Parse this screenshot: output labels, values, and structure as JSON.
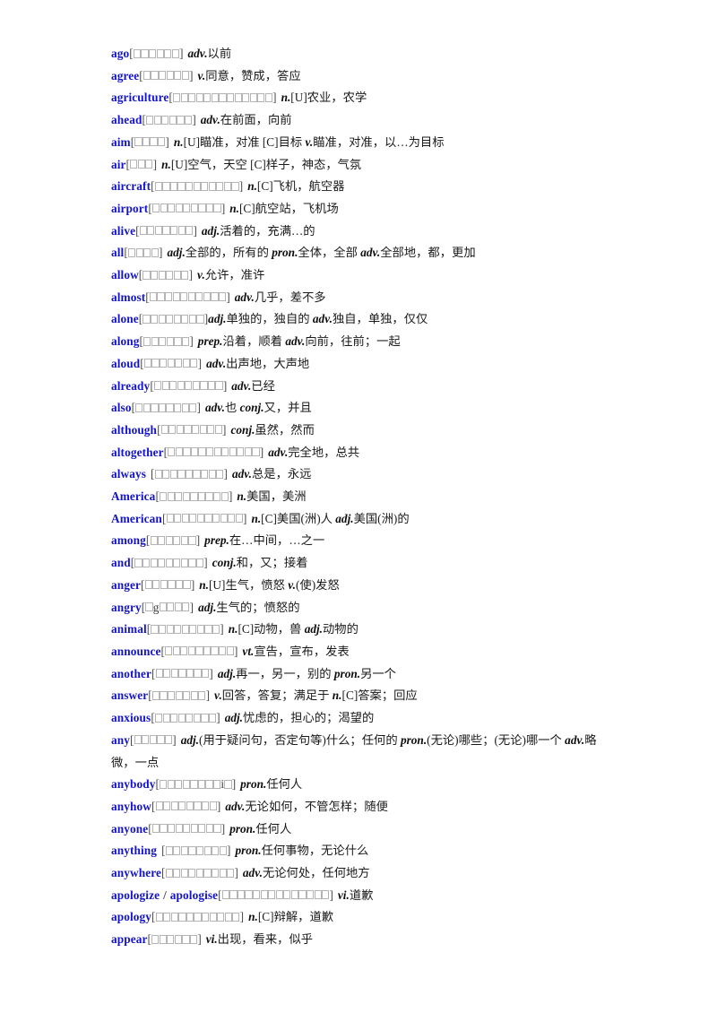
{
  "document": {
    "type": "vocabulary-word-list",
    "page_background": "#ffffff",
    "headword_color": "#1414c8",
    "text_color": "#1a1a1a",
    "phonetic_box_color": "#b4b4b4",
    "note": "Phonetic transcriptions render as missing-glyph (tofu) boxes."
  },
  "entries": [
    {
      "word": "ago",
      "space_before_bracket": false,
      "phonetic_boxes": 6,
      "phonetic_literals": {},
      "space_after_bracket": true,
      "senses": "adv.以前"
    },
    {
      "word": "agree",
      "space_before_bracket": false,
      "phonetic_boxes": 6,
      "phonetic_literals": {},
      "space_after_bracket": true,
      "senses": "v.同意，赞成，答应"
    },
    {
      "word": "agriculture",
      "space_before_bracket": false,
      "phonetic_boxes": 13,
      "phonetic_literals": {},
      "space_after_bracket": true,
      "senses": "n.[U]农业，农学"
    },
    {
      "word": "ahead",
      "space_before_bracket": false,
      "phonetic_boxes": 6,
      "phonetic_literals": {},
      "space_after_bracket": true,
      "senses": "adv.在前面，向前"
    },
    {
      "word": "aim",
      "space_before_bracket": false,
      "phonetic_boxes": 4,
      "phonetic_literals": {},
      "space_after_bracket": true,
      "senses": "n.[U]瞄准，对准 [C]目标 v.瞄准，对准，以…为目标"
    },
    {
      "word": "air",
      "space_before_bracket": false,
      "phonetic_boxes": 3,
      "phonetic_literals": {},
      "space_after_bracket": true,
      "senses": "n.[U]空气，天空 [C]样子，神态，气氛"
    },
    {
      "word": "aircraft",
      "space_before_bracket": false,
      "phonetic_boxes": 11,
      "phonetic_literals": {},
      "space_after_bracket": true,
      "senses": "n.[C]飞机，航空器"
    },
    {
      "word": "airport",
      "space_before_bracket": false,
      "phonetic_boxes": 9,
      "phonetic_literals": {},
      "space_after_bracket": true,
      "senses": "n.[C]航空站，飞机场"
    },
    {
      "word": "alive",
      "space_before_bracket": false,
      "phonetic_boxes": 7,
      "phonetic_literals": {},
      "space_after_bracket": true,
      "senses": "adj.活着的，充满…的"
    },
    {
      "word": "all",
      "space_before_bracket": false,
      "phonetic_boxes": 4,
      "phonetic_literals": {},
      "space_after_bracket": true,
      "senses": "adj.全部的，所有的 pron.全体，全部 adv.全部地，都，更加"
    },
    {
      "word": "allow",
      "space_before_bracket": false,
      "phonetic_boxes": 6,
      "phonetic_literals": {},
      "space_after_bracket": true,
      "senses": "v.允许，准许"
    },
    {
      "word": "almost",
      "space_before_bracket": false,
      "phonetic_boxes": 10,
      "phonetic_literals": {},
      "space_after_bracket": true,
      "senses": "adv.几乎，差不多"
    },
    {
      "word": "alone",
      "space_before_bracket": false,
      "phonetic_boxes": 8,
      "phonetic_literals": {},
      "space_after_bracket": false,
      "senses": "adj.单独的，独自的 adv.独自，单独，仅仅"
    },
    {
      "word": "along",
      "space_before_bracket": false,
      "phonetic_boxes": 6,
      "phonetic_literals": {},
      "space_after_bracket": true,
      "senses": "prep.沿着，顺着 adv.向前，往前；一起"
    },
    {
      "word": "aloud",
      "space_before_bracket": false,
      "phonetic_boxes": 7,
      "phonetic_literals": {},
      "space_after_bracket": true,
      "senses": "adv.出声地，大声地"
    },
    {
      "word": "already",
      "space_before_bracket": false,
      "phonetic_boxes": 9,
      "phonetic_literals": {},
      "space_after_bracket": true,
      "senses": "adv.已经"
    },
    {
      "word": "also",
      "space_before_bracket": false,
      "phonetic_boxes": 8,
      "phonetic_literals": {},
      "space_after_bracket": true,
      "senses": "adv.也 conj.又，并且"
    },
    {
      "word": "although",
      "space_before_bracket": false,
      "phonetic_boxes": 8,
      "phonetic_literals": {},
      "space_after_bracket": true,
      "senses": "conj.虽然，然而"
    },
    {
      "word": "altogether",
      "space_before_bracket": false,
      "phonetic_boxes": 12,
      "phonetic_literals": {},
      "space_after_bracket": true,
      "senses": "adv.完全地，总共"
    },
    {
      "word": "always",
      "space_before_bracket": true,
      "phonetic_boxes": 9,
      "phonetic_literals": {},
      "space_after_bracket": true,
      "senses": "adv.总是，永远"
    },
    {
      "word": "America",
      "space_before_bracket": false,
      "phonetic_boxes": 9,
      "phonetic_literals": {},
      "space_after_bracket": true,
      "senses": "n.美国，美洲"
    },
    {
      "word": "American",
      "space_before_bracket": false,
      "phonetic_boxes": 10,
      "phonetic_literals": {},
      "space_after_bracket": true,
      "senses": "n.[C]美国(洲)人 adj.美国(洲)的"
    },
    {
      "word": "among",
      "space_before_bracket": false,
      "phonetic_boxes": 6,
      "phonetic_literals": {},
      "space_after_bracket": true,
      "senses": "prep.在…中间，…之一"
    },
    {
      "word": "and",
      "space_before_bracket": false,
      "phonetic_boxes": 9,
      "phonetic_literals": {},
      "space_after_bracket": true,
      "senses": "conj.和，又；接着"
    },
    {
      "word": "anger",
      "space_before_bracket": false,
      "phonetic_boxes": 6,
      "phonetic_literals": {},
      "space_after_bracket": true,
      "senses": "n.[U]生气，愤怒 v.(使)发怒"
    },
    {
      "word": "angry",
      "space_before_bracket": false,
      "phonetic_boxes": 6,
      "phonetic_literals": {
        "2": "g"
      },
      "space_after_bracket": true,
      "senses": "adj.生气的；愤怒的"
    },
    {
      "word": "animal",
      "space_before_bracket": false,
      "phonetic_boxes": 9,
      "phonetic_literals": {},
      "space_after_bracket": true,
      "senses": "n.[C]动物，兽 adj.动物的"
    },
    {
      "word": "announce",
      "space_before_bracket": false,
      "phonetic_boxes": 9,
      "phonetic_literals": {},
      "space_after_bracket": true,
      "senses": "vt.宣告，宣布，发表"
    },
    {
      "word": "another",
      "space_before_bracket": false,
      "phonetic_boxes": 7,
      "phonetic_literals": {},
      "space_after_bracket": true,
      "senses": "adj.再一，另一，别的 pron.另一个"
    },
    {
      "word": "answer",
      "space_before_bracket": false,
      "phonetic_boxes": 7,
      "phonetic_literals": {},
      "space_after_bracket": true,
      "senses": "v.回答，答复；满足于 n.[C]答案；回应"
    },
    {
      "word": "anxious",
      "space_before_bracket": false,
      "phonetic_boxes": 8,
      "phonetic_literals": {},
      "space_after_bracket": true,
      "senses": "adj.忧虑的，担心的；渴望的"
    },
    {
      "word": "any",
      "space_before_bracket": false,
      "phonetic_boxes": 5,
      "phonetic_literals": {},
      "space_after_bracket": true,
      "senses": "adj.(用于疑问句，否定句等)什么；任何的 pron.(无论)哪些；(无论)哪一个 adv.略微，一点"
    },
    {
      "word": "anybody",
      "space_before_bracket": false,
      "phonetic_boxes": 10,
      "phonetic_literals": {
        "9": "i"
      },
      "space_after_bracket": true,
      "senses": "pron.任何人"
    },
    {
      "word": "anyhow",
      "space_before_bracket": false,
      "phonetic_boxes": 8,
      "phonetic_literals": {},
      "space_after_bracket": true,
      "senses": "adv.无论如何，不管怎样；随便"
    },
    {
      "word": "anyone",
      "space_before_bracket": false,
      "phonetic_boxes": 9,
      "phonetic_literals": {},
      "space_after_bracket": true,
      "senses": "pron.任何人"
    },
    {
      "word": "anything",
      "space_before_bracket": true,
      "phonetic_boxes": 8,
      "phonetic_literals": {},
      "space_after_bracket": true,
      "senses": "pron.任何事物，无论什么"
    },
    {
      "word": "anywhere",
      "space_before_bracket": false,
      "phonetic_boxes": 9,
      "phonetic_literals": {},
      "space_after_bracket": true,
      "senses": "adv.无论何处，任何地方"
    },
    {
      "word": "apologize",
      "alt_word": "apologise",
      "separator": "/",
      "space_before_bracket": false,
      "phonetic_boxes": 14,
      "phonetic_literals": {},
      "space_after_bracket": true,
      "senses": "vi.道歉"
    },
    {
      "word": "apology",
      "space_before_bracket": false,
      "phonetic_boxes": 11,
      "phonetic_literals": {},
      "space_after_bracket": true,
      "senses": "n.[C]辩解，道歉"
    },
    {
      "word": "appear",
      "space_before_bracket": false,
      "phonetic_boxes": 6,
      "phonetic_literals": {},
      "space_after_bracket": true,
      "senses": "vi.出现，看来，似乎"
    }
  ]
}
